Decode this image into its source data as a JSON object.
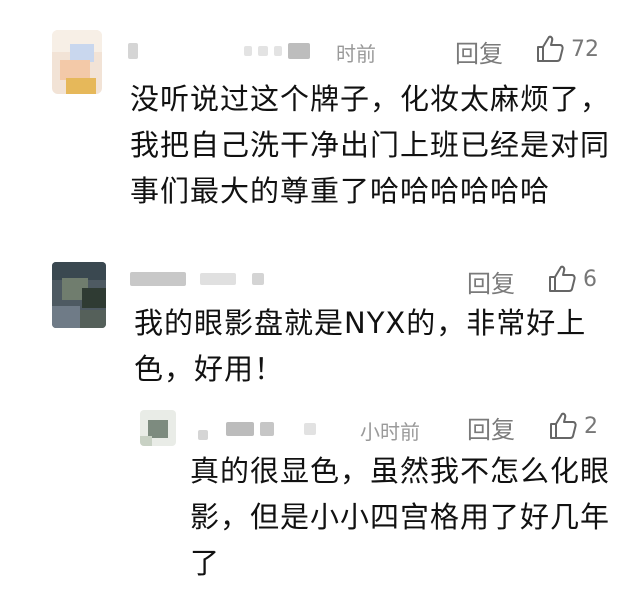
{
  "comments": [
    {
      "time": "时前",
      "reply_label": "回复",
      "likes": "72",
      "text": "没听说过这个牌子，化妆太麻烦了，\n我把自己洗干净出门上班已经是对同\n事们最大的尊重了哈哈哈哈哈哈"
    },
    {
      "time": "",
      "reply_label": "回复",
      "likes": "6",
      "text": "我的眼影盘就是NYX的，非常好上\n色，好用！"
    },
    {
      "time": "小时前",
      "reply_label": "回复",
      "likes": "2",
      "text": "真的很显色，虽然我不怎么化眼\n影，但是小小四宫格用了好几年\n了"
    }
  ],
  "icons": {
    "like": "thumbs-up-icon",
    "avatar": "blurred-avatar"
  },
  "colors": {
    "background": "#ffffff",
    "text": "#111111",
    "meta": "#9a9a9a",
    "reply": "#7a7a7a"
  }
}
